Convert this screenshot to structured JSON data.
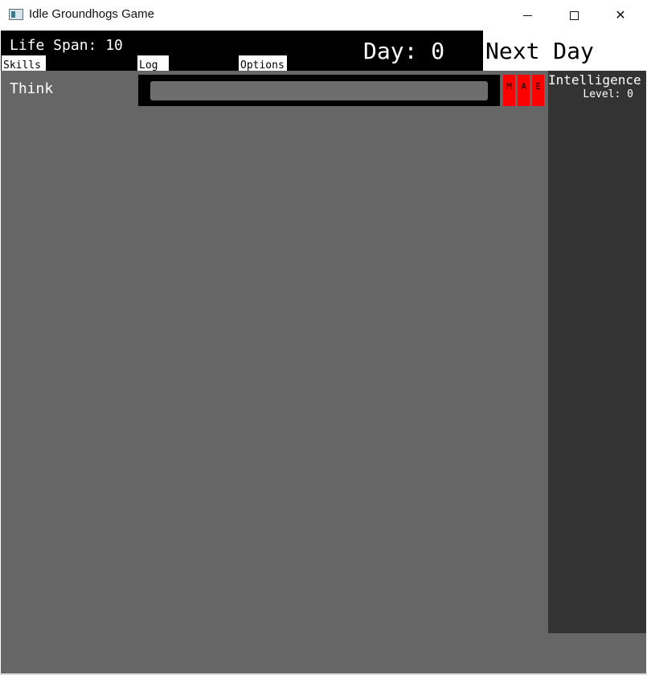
{
  "window": {
    "title": "Idle Groundhogs Game",
    "icon": "app-window-icon",
    "controls": {
      "minimize": "minimize-icon",
      "maximize": "maximize-icon",
      "close": "✕"
    }
  },
  "header": {
    "life_span_label": "Life Span: 10",
    "day_label": "Day: 0",
    "next_day_label": "Next Day"
  },
  "tabs": [
    {
      "label": "Skills"
    },
    {
      "label": "Log"
    },
    {
      "label": "Options"
    }
  ],
  "skill": {
    "name": "Think",
    "progress": 0,
    "modifiers": [
      "M",
      "A",
      "E"
    ]
  },
  "stats": {
    "name": "Intelligence",
    "level_label": "Level: 0"
  },
  "colors": {
    "client_bg": "#666666",
    "header_bg": "#000000",
    "modifier_bg": "#ff0000",
    "stats_bg": "#333333"
  }
}
